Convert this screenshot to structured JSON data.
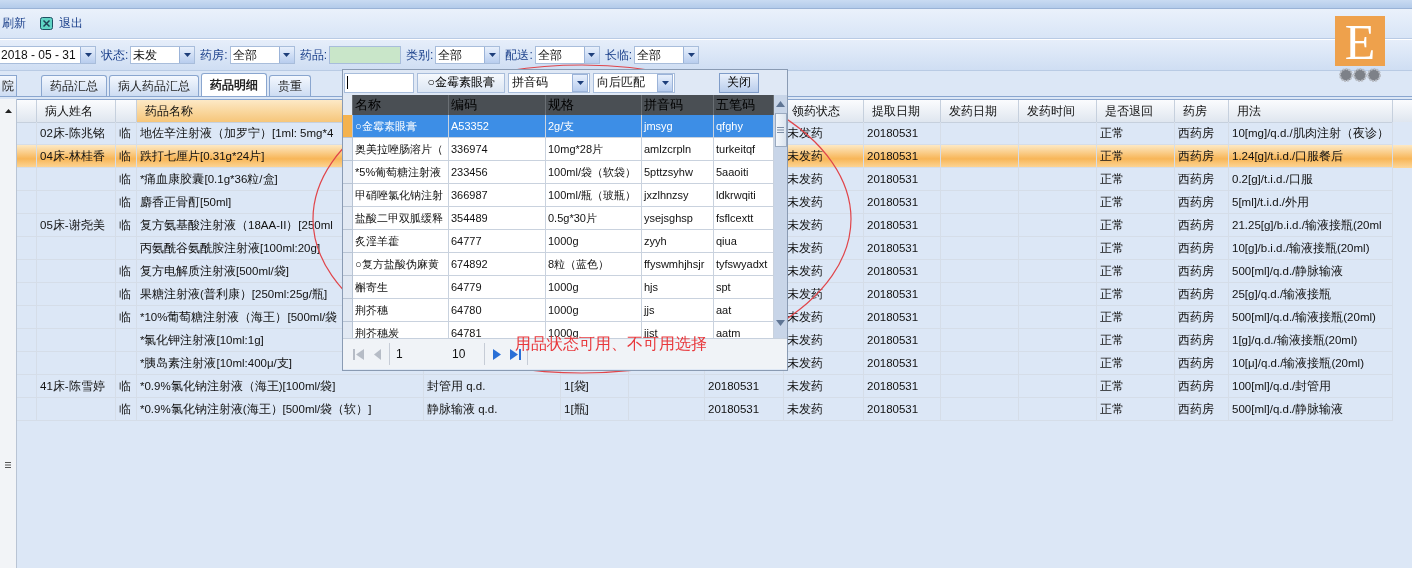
{
  "toolbar": [
    {
      "label": "刷新",
      "kind": "plain"
    },
    {
      "label": "退出",
      "kind": "exit"
    }
  ],
  "filters": [
    {
      "kind": "date",
      "value": "2018 - 05 - 31"
    },
    {
      "kind": "select",
      "label": "状态:",
      "value": "未发"
    },
    {
      "kind": "select",
      "label": "药房:",
      "value": "全部"
    },
    {
      "kind": "input",
      "label": "药品:"
    },
    {
      "kind": "select",
      "label": "类别:",
      "value": "全部"
    },
    {
      "kind": "select",
      "label": "配送:",
      "value": "全部"
    },
    {
      "kind": "select",
      "label": "长临:",
      "value": "全部"
    }
  ],
  "logo": {
    "letter": "E"
  },
  "tabs": [
    {
      "label": "院",
      "selected": false
    },
    {
      "label": "药品汇总",
      "selected": false
    },
    {
      "label": "病人药品汇总",
      "selected": false
    },
    {
      "label": "药品明细",
      "selected": true
    },
    {
      "label": "贵重",
      "selected": false
    }
  ],
  "table": {
    "columns": [
      {
        "label": "病人姓名"
      },
      {},
      {
        "label": "药品名称",
        "sorted": true
      },
      {},
      {},
      {},
      {},
      {
        "label": "领药状态"
      },
      {
        "label": "提取日期"
      },
      {
        "label": "发药日期"
      },
      {
        "label": "发药时间"
      },
      {
        "label": "是否退回"
      },
      {
        "label": "药房"
      },
      {
        "label": "用法"
      }
    ],
    "rows": [
      {
        "selected": false,
        "cells": [
          "02床-陈兆铭",
          "临",
          "地佐辛注射液（加罗宁）[1ml: 5mg*4",
          null,
          null,
          null,
          null,
          "未发药",
          "20180531",
          null,
          null,
          "正常",
          "西药房",
          "10[mg]/q.d./肌肉注射（夜诊）"
        ]
      },
      {
        "selected": true,
        "cells": [
          "04床-林桂香",
          "临",
          "跌打七厘片[0.31g*24片]",
          null,
          null,
          null,
          null,
          "未发药",
          "20180531",
          null,
          null,
          "正常",
          "西药房",
          "1.24[g]/t.i.d./口服餐后"
        ]
      },
      {
        "selected": false,
        "cells": [
          null,
          "临",
          "*痛血康胶囊[0.1g*36粒/盒]",
          null,
          null,
          null,
          null,
          "未发药",
          "20180531",
          null,
          null,
          "正常",
          "西药房",
          "0.2[g]/t.i.d./口服"
        ]
      },
      {
        "selected": false,
        "cells": [
          null,
          "临",
          "麝香正骨酊[50ml]",
          null,
          null,
          null,
          null,
          "未发药",
          "20180531",
          null,
          null,
          "正常",
          "西药房",
          "5[ml]/t.i.d./外用"
        ]
      },
      {
        "selected": false,
        "cells": [
          "05床-谢尧美",
          "临",
          "复方氨基酸注射液（18AA-II）[250ml",
          null,
          null,
          null,
          null,
          "未发药",
          "20180531",
          null,
          null,
          "正常",
          "西药房",
          "21.25[g]/b.i.d./输液接瓶(20ml"
        ]
      },
      {
        "selected": false,
        "cells": [
          null,
          null,
          "丙氨酰谷氨酰胺注射液[100ml:20g]",
          null,
          null,
          null,
          null,
          "未发药",
          "20180531",
          null,
          null,
          "正常",
          "西药房",
          "10[g]/b.i.d./输液接瓶(20ml)"
        ]
      },
      {
        "selected": false,
        "cells": [
          null,
          "临",
          "复方电解质注射液[500ml/袋]",
          null,
          null,
          null,
          null,
          "未发药",
          "20180531",
          null,
          null,
          "正常",
          "西药房",
          "500[ml]/q.d./静脉输液"
        ]
      },
      {
        "selected": false,
        "cells": [
          null,
          "临",
          "果糖注射液(普利康）[250ml:25g/瓶]",
          null,
          null,
          null,
          null,
          "未发药",
          "20180531",
          null,
          null,
          "正常",
          "西药房",
          "25[g]/q.d./输液接瓶"
        ]
      },
      {
        "selected": false,
        "cells": [
          null,
          "临",
          "*10%葡萄糖注射液（海王）[500ml/袋",
          null,
          null,
          null,
          null,
          "未发药",
          "20180531",
          null,
          null,
          "正常",
          "西药房",
          "500[ml]/q.d./输液接瓶(20ml)"
        ]
      },
      {
        "selected": false,
        "cells": [
          null,
          null,
          "*氯化钾注射液[10ml:1g]",
          null,
          null,
          null,
          null,
          "未发药",
          "20180531",
          null,
          null,
          "正常",
          "西药房",
          "1[g]/q.d./输液接瓶(20ml)"
        ]
      },
      {
        "selected": false,
        "cells": [
          null,
          null,
          "*胰岛素注射液[10ml:400μ/支]",
          null,
          null,
          null,
          null,
          "未发药",
          "20180531",
          null,
          null,
          "正常",
          "西药房",
          "10[μ]/q.d./输液接瓶(20ml)"
        ]
      },
      {
        "selected": false,
        "cells": [
          "41床-陈雪婷",
          "临",
          "*0.9%氯化钠注射液（海王)[100ml/袋]",
          "封管用 q.d.",
          "1[袋]",
          null,
          "20180531",
          "未发药",
          "20180531",
          null,
          null,
          "正常",
          "西药房",
          "100[ml]/q.d./封管用"
        ]
      },
      {
        "selected": false,
        "cells": [
          null,
          "临",
          "*0.9%氯化钠注射液(海王）[500ml/袋（软）]",
          "静脉输液 q.d.",
          "1[瓶]",
          null,
          "20180531",
          "未发药",
          "20180531",
          null,
          null,
          "正常",
          "西药房",
          "500[ml]/q.d./静脉输液"
        ]
      }
    ]
  },
  "picker": {
    "search": {
      "focused": true
    },
    "current": "○金霉素眼膏",
    "selects": [
      "拼音码",
      "向后匹配"
    ],
    "close": "关闭",
    "columns": [
      "名称",
      "编码",
      "规格",
      "拼音码",
      "五笔码"
    ],
    "rows": [
      {
        "selected": true,
        "cells": [
          "○金霉素眼膏",
          "A53352",
          "2g/支",
          "jmsyg",
          "qfghy"
        ]
      },
      {
        "selected": false,
        "cells": [
          "奥美拉唑肠溶片（",
          "336974",
          "10mg*28片",
          "amlzcrpln",
          "turkeitqf"
        ]
      },
      {
        "selected": false,
        "cells": [
          "*5%葡萄糖注射液",
          "233456",
          "100ml/袋（软袋）",
          "5pttzsyhw",
          "5aaoiti"
        ]
      },
      {
        "selected": false,
        "cells": [
          "甲硝唑氯化钠注射",
          "366987",
          "100ml/瓶（玻瓶）",
          "jxzlhnzsy",
          "ldkrwqiti"
        ]
      },
      {
        "selected": false,
        "cells": [
          "盐酸二甲双胍缓释",
          "354489",
          "0.5g*30片",
          "ysejsghsp",
          "fsflcextt"
        ]
      },
      {
        "selected": false,
        "cells": [
          "炙淫羊藿",
          "64777",
          "1000g",
          "zyyh",
          "qiua"
        ]
      },
      {
        "selected": false,
        "cells": [
          "○复方盐酸伪麻黄",
          "674892",
          "8粒（蓝色）",
          "ffyswmhjhsjr",
          "tyfswyadxt"
        ]
      },
      {
        "selected": false,
        "cells": [
          "槲寄生",
          "64779",
          "1000g",
          "hjs",
          "spt"
        ]
      },
      {
        "selected": false,
        "cells": [
          "荆芥穗",
          "64780",
          "1000g",
          "jjs",
          "aat"
        ]
      },
      {
        "selected": false,
        "cells": [
          "荆芥穗炭",
          "64781",
          "1000g",
          "jjst",
          "aatm"
        ]
      }
    ],
    "pager": {
      "page": "1",
      "count": "10"
    }
  },
  "annotation": {
    "text": "用品状态可用、不可用选择"
  }
}
